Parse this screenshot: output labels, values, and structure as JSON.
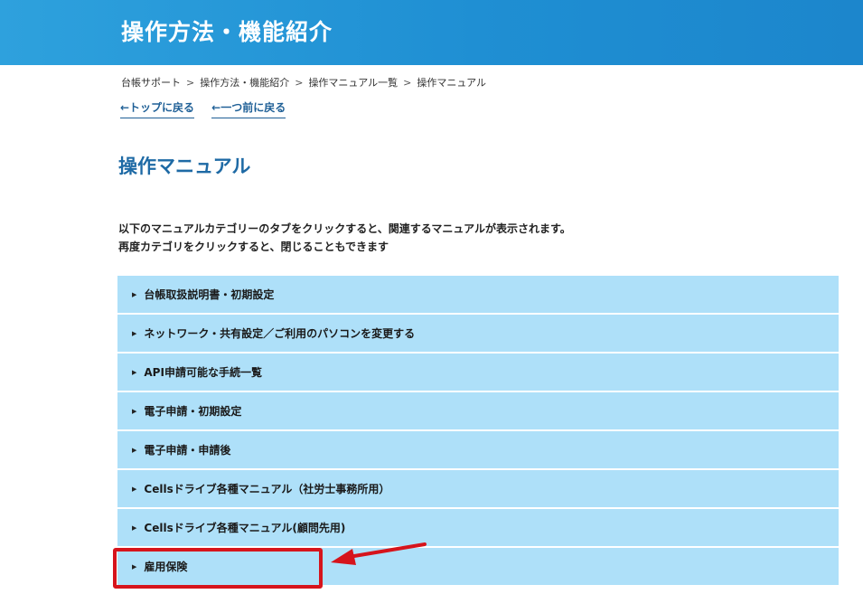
{
  "header": {
    "title": "操作方法・機能紹介"
  },
  "breadcrumb": [
    {
      "label": "台帳サポート"
    },
    {
      "label": "操作方法・機能紹介"
    },
    {
      "label": "操作マニュアル一覧"
    },
    {
      "label": "操作マニュアル"
    }
  ],
  "back_links": {
    "top": "←トップに戻る",
    "prev": "←一つ前に戻る"
  },
  "page_title": "操作マニュアル",
  "intro": {
    "line1": "以下のマニュアルカテゴリーのタブをクリックすると、関連するマニュアルが表示されます。",
    "line2": "再度カテゴリをクリックすると、閉じることもできます"
  },
  "categories": [
    {
      "label": "台帳取扱説明書・初期設定"
    },
    {
      "label": "ネットワーク・共有設定／ご利用のパソコンを変更する"
    },
    {
      "label": "API申請可能な手続一覧"
    },
    {
      "label": "電子申請・初期設定"
    },
    {
      "label": "電子申請・申請後"
    },
    {
      "label": "Cellsドライブ各種マニュアル（社労士事務所用）"
    },
    {
      "label": "Cellsドライブ各種マニュアル(顧問先用)"
    },
    {
      "label": "雇用保険"
    }
  ],
  "colors": {
    "header_bg": "#1f8fd3",
    "accordion_bg": "#aee0f9",
    "title_blue": "#1e6aa5",
    "highlight_red": "#d6141c"
  }
}
